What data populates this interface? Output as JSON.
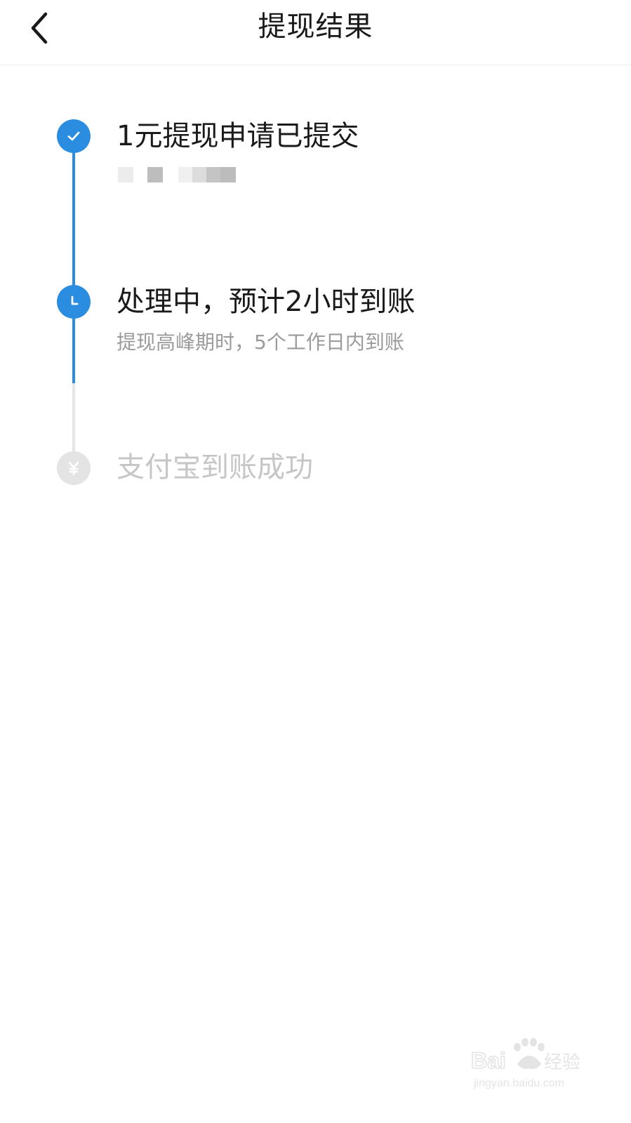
{
  "nav": {
    "title": "提现结果",
    "back_icon": "chevron-left-icon"
  },
  "steps": [
    {
      "title": "1元提现申请已提交",
      "status": "done",
      "icon": "check-icon"
    },
    {
      "title": "处理中，预计2小时到账",
      "subtitle": "提现高峰期时，5个工作日内到账",
      "status": "processing",
      "icon": "clock-icon"
    },
    {
      "title": "支付宝到账成功",
      "status": "pending",
      "icon": "yuan-icon"
    }
  ],
  "colors": {
    "accent": "#2a8de0",
    "inactive": "#e4e4e4",
    "inactive_text": "#c6c6c6",
    "subtitle_text": "#9b9b9b"
  },
  "watermark": {
    "brand": "Baidu经验",
    "url": "jingyan.baidu.com"
  }
}
